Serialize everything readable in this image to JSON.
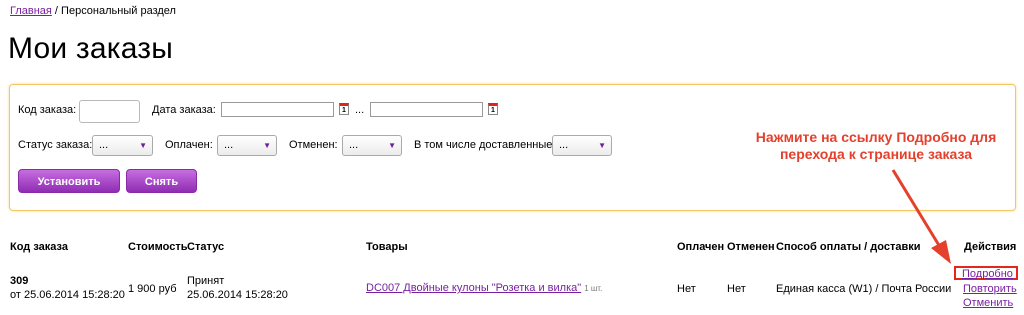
{
  "breadcrumb": {
    "home": "Главная",
    "sep": " / ",
    "current": "Персональный раздел"
  },
  "page_title": "Мои заказы",
  "filters": {
    "order_code_label": "Код заказа:",
    "order_date_label": "Дата заказа:",
    "date_sep": "...",
    "calendar_glyph": "1",
    "status_label": "Статус заказа:",
    "paid_label": "Оплачен:",
    "canceled_label": "Отменен:",
    "delivered_label": "В том числе доставленные:",
    "select_value": "...",
    "apply_button": "Установить",
    "reset_button": "Снять"
  },
  "annotation": "Нажмите на ссылку Подробно для перехода к странице заказа",
  "table": {
    "headers": {
      "order_code": "Код заказа",
      "cost": "Стоимость",
      "status": "Статус",
      "goods": "Товары",
      "paid": "Оплачен",
      "canceled": "Отменен",
      "payment_delivery": "Способ оплаты / доставки",
      "actions": "Действия"
    },
    "rows": [
      {
        "code": "309",
        "code_date": "от 25.06.2014 15:28:20",
        "cost": "1 900 руб",
        "status": "Принят",
        "status_date": "25.06.2014 15:28:20",
        "goods_link": "DC007 Двойные кулоны \"Розетка и вилка\"",
        "goods_qty": "1 шт.",
        "paid": "Нет",
        "canceled": "Нет",
        "payment_delivery": "Единая касса (W1) / Почта России",
        "actions": [
          "Подробно",
          "Повторить",
          "Отменить"
        ]
      }
    ]
  },
  "colors": {
    "accent": "#9b3fc4",
    "annotation": "#e4402c",
    "box_border": "#f2c566"
  }
}
